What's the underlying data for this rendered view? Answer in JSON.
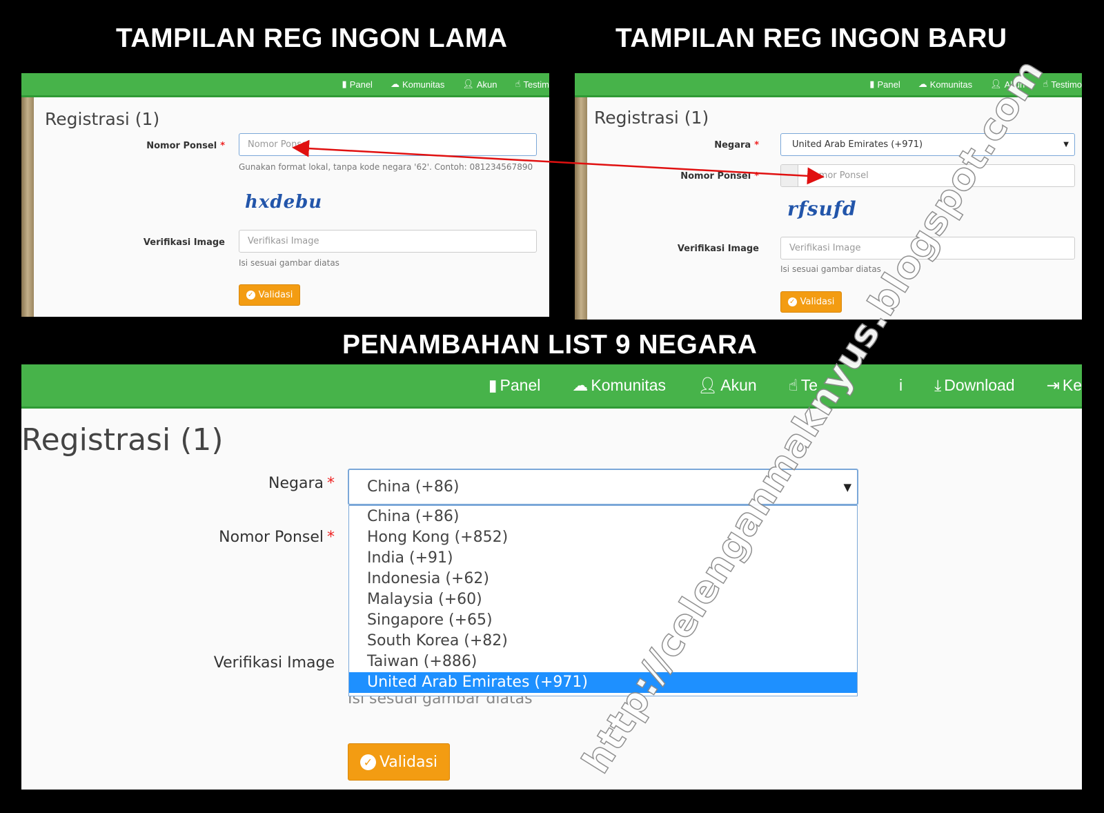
{
  "headings": {
    "old": "TAMPILAN REG INGON LAMA",
    "new": "TAMPILAN REG INGON BARU",
    "list": "PENAMBAHAN LIST 9 NEGARA"
  },
  "nav": {
    "panel": "Panel",
    "komunitas": "Komunitas",
    "akun": "Akun",
    "testimoni_cut": "Testim",
    "testimoni_cut_new": "Testimo",
    "testimoni_cut_big": "Te",
    "testimoni_tail_big": "i",
    "download": "Download",
    "keluar_cut": "Ke"
  },
  "form": {
    "title": "Registrasi (1)",
    "negara_label": "Negara",
    "nomor_label": "Nomor Ponsel",
    "verif_label": "Verifikasi Image",
    "required_mark": "*",
    "nomor_placeholder": "Nomor Ponsel",
    "verif_placeholder": "Verifikasi Image",
    "nomor_help": "Gunakan format lokal, tanpa kode negara '62'. Contoh: 081234567890",
    "verif_help": "Isi sesuai gambar diatas",
    "button": "Validasi"
  },
  "old_panel": {
    "captcha": "hxdebu"
  },
  "new_panel": {
    "captcha": "rfsufd",
    "negara_value": "United Arab Emirates (+971)"
  },
  "big_panel": {
    "negara_value": "China (+86)",
    "options": [
      "China (+86)",
      "Hong Kong (+852)",
      "India (+91)",
      "Indonesia (+62)",
      "Malaysia (+60)",
      "Singapore (+65)",
      "South Korea (+82)",
      "Taiwan (+886)",
      "United Arab Emirates (+971)"
    ],
    "selected_option": "United Arab Emirates (+971)"
  },
  "watermark": "http://celenganmaknyus.blogspot.com",
  "colors": {
    "navbar": "#47b34a",
    "button": "#f39c12",
    "highlight": "#1e90ff",
    "arrow": "#e01010"
  }
}
